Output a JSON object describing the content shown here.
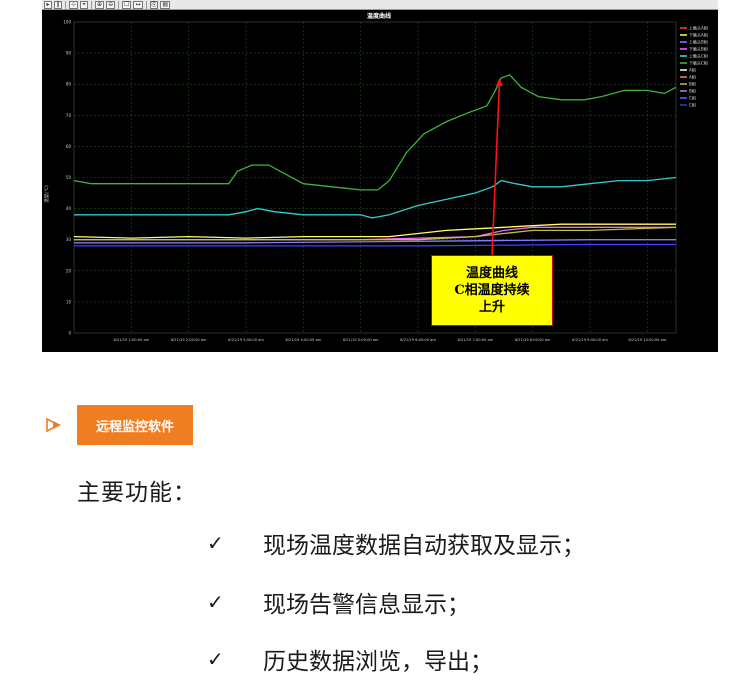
{
  "toolbar": {
    "buttons": [
      "▸",
      "‖",
      "⊹",
      "⌖",
      "⊕",
      "⊖",
      "☐",
      "↔",
      "⎘",
      "▤"
    ]
  },
  "chart_data": {
    "type": "line",
    "title": "温度曲线",
    "ylabel": "温度(℃)",
    "ylim": [
      0,
      100
    ],
    "yticks": [
      0,
      10,
      20,
      30,
      40,
      50,
      60,
      70,
      80,
      90,
      100
    ],
    "xticks": [
      "6/21/19 1:00:00 am",
      "6/21/19 2:00:00 am",
      "6/21/19 3:00:00 am",
      "6/21/19 4:00:00 am",
      "6/21/19 5:00:00 am",
      "6/21/19 6:00:00 am",
      "6/21/19 7:00:00 am",
      "6/21/19 8:00:00 am",
      "6/21/19 9:00:00 am",
      "6/21/19 10:00:00 am"
    ],
    "xrange": [
      0,
      10.5
    ],
    "legend": "right",
    "legend_entries": [
      {
        "name": "上触头A相",
        "color": "#ff4040"
      },
      {
        "name": "下触头A相",
        "color": "#ffff66"
      },
      {
        "name": "上触头B相",
        "color": "#8080ff"
      },
      {
        "name": "下触头B相",
        "color": "#ff66ff"
      },
      {
        "name": "上触头C相",
        "color": "#40e0e0"
      },
      {
        "name": "下触头C相",
        "color": "#40c040"
      },
      {
        "name": "A相",
        "color": "#ffffff"
      },
      {
        "name": "A相",
        "color": "#ff8080"
      },
      {
        "name": "B相",
        "color": "#c0c040"
      },
      {
        "name": "B相",
        "color": "#c080c0"
      },
      {
        "name": "C相",
        "color": "#6060ff"
      },
      {
        "name": "C相",
        "color": "#4040a0"
      }
    ],
    "series": [
      {
        "color": "#3cb33c",
        "x": [
          0,
          0.3,
          1.0,
          2.0,
          2.7,
          2.85,
          3.1,
          3.4,
          3.7,
          4.0,
          4.5,
          5.0,
          5.3,
          5.5,
          5.8,
          6.1,
          6.5,
          6.9,
          7.2,
          7.35,
          7.45,
          7.6,
          7.8,
          8.1,
          8.5,
          8.9,
          9.2,
          9.6,
          10.0,
          10.3,
          10.5
        ],
        "y": [
          49,
          48,
          48,
          48,
          48,
          52,
          54,
          54,
          51,
          48,
          47,
          46,
          46,
          49,
          58,
          64,
          68,
          71,
          73,
          78,
          82,
          83,
          79,
          76,
          75,
          75,
          76,
          78,
          78,
          77,
          79
        ]
      },
      {
        "color": "#33cccc",
        "x": [
          0,
          1.0,
          2.0,
          2.7,
          3.0,
          3.2,
          3.5,
          4.0,
          4.5,
          5.0,
          5.2,
          5.5,
          6.0,
          6.5,
          7.0,
          7.3,
          7.45,
          7.7,
          8.0,
          8.5,
          9.0,
          9.5,
          10.0,
          10.5
        ],
        "y": [
          38,
          38,
          38,
          38,
          39,
          40,
          39,
          38,
          38,
          38,
          37,
          38,
          41,
          43,
          45,
          47,
          49,
          48,
          47,
          47,
          48,
          49,
          49,
          50
        ]
      },
      {
        "color": "#ffff66",
        "x": [
          0,
          1.0,
          2.0,
          3.0,
          4.0,
          5.0,
          5.5,
          6.0,
          6.5,
          7.0,
          7.5,
          8.0,
          8.5,
          9.0,
          9.5,
          10.0,
          10.5
        ],
        "y": [
          31,
          30.5,
          31,
          30.5,
          31,
          31,
          31,
          32,
          33,
          33.5,
          34,
          34.5,
          35,
          35,
          35,
          35,
          35
        ]
      },
      {
        "color": "#ff66ff",
        "x": [
          0,
          2.0,
          4.0,
          5.0,
          6.0,
          7.0,
          7.5,
          8.0,
          9.0,
          10.0,
          10.5
        ],
        "y": [
          30,
          30,
          30,
          30,
          30.5,
          31,
          33,
          34,
          34,
          34,
          34
        ]
      },
      {
        "color": "#c0c040",
        "x": [
          0,
          2.0,
          4.0,
          6.0,
          7.0,
          7.5,
          8.0,
          9.0,
          10.5
        ],
        "y": [
          30,
          30,
          30,
          30,
          31,
          32,
          33,
          33,
          34
        ]
      },
      {
        "color": "#8080ff",
        "x": [
          0,
          3.0,
          6.0,
          9.0,
          10.5
        ],
        "y": [
          29,
          29,
          29.5,
          30,
          30
        ]
      },
      {
        "color": "#4040ff",
        "x": [
          0,
          3.0,
          6.0,
          9.0,
          10.5
        ],
        "y": [
          28,
          28,
          28,
          28.5,
          28.5
        ]
      }
    ]
  },
  "callout": {
    "line1": "温度曲线",
    "line2": "C相温度持续",
    "line3": "上升",
    "arrow_to": {
      "x": 7.42,
      "y": 82
    }
  },
  "section": {
    "title": "远程监控软件",
    "accent": "#ef7d22"
  },
  "features": {
    "heading": "主要功能：",
    "check": "✓",
    "items": [
      "现场温度数据自动获取及显示；",
      "现场告警信息显示；",
      "历史数据浏览，导出；"
    ]
  }
}
